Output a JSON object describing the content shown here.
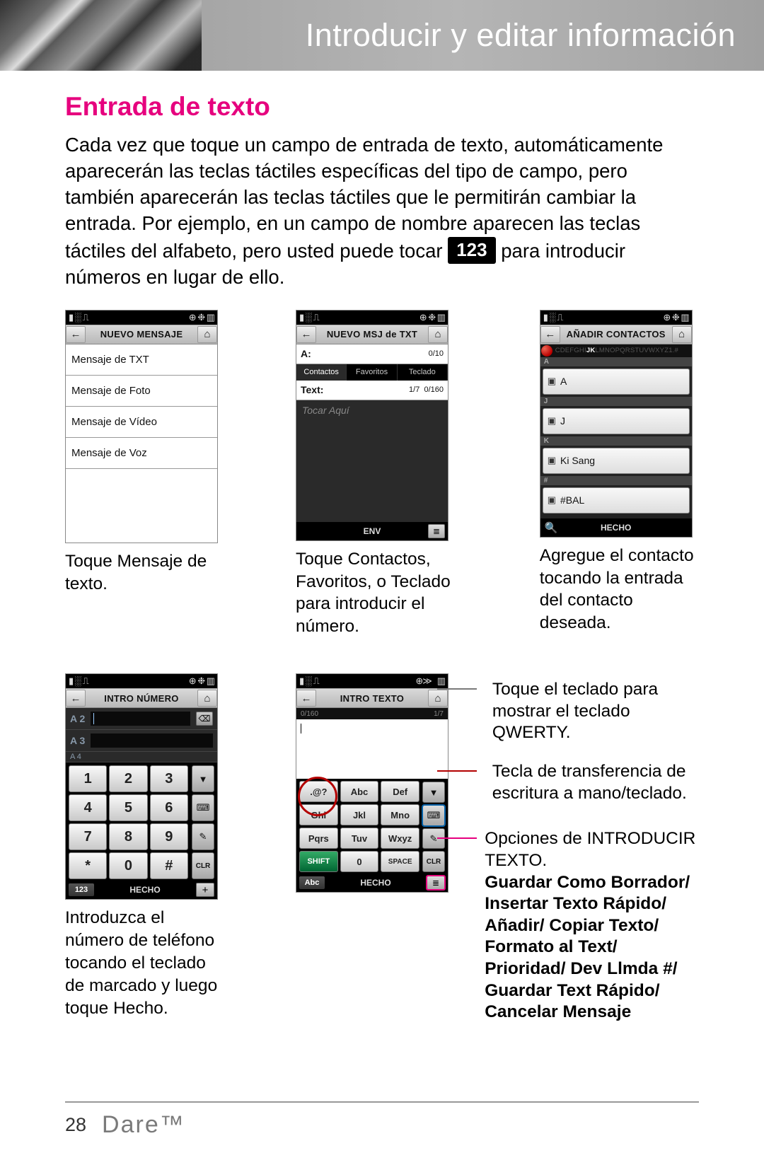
{
  "header": {
    "title": "Introducir y editar información"
  },
  "section": {
    "title": "Entrada de texto"
  },
  "body": {
    "p1a": "Cada vez que toque un campo de entrada de texto, automáticamente aparecerán las teclas táctiles específicas del tipo de campo, pero también aparecerán las teclas táctiles que le permitirán cambiar la entrada. Por ejemplo, en un campo de nombre aparecen las teclas táctiles del alfabeto, pero usted puede tocar ",
    "key_badge": "123",
    "p1b": " para introducir números en lugar de ello."
  },
  "phones": {
    "p1": {
      "title": "NUEVO MENSAJE",
      "items": [
        "Mensaje de TXT",
        "Mensaje de Foto",
        "Mensaje de Vídeo",
        "Mensaje de Voz"
      ],
      "caption": "Toque Mensaje de texto."
    },
    "p2": {
      "title": "NUEVO MSJ de TXT",
      "field_a": "A:",
      "count_a": "0/10",
      "tabs": [
        "Contactos",
        "Favoritos",
        "Teclado"
      ],
      "field_txt": "Text:",
      "count_txt_left": "1/7",
      "count_txt_right": "0/160",
      "placeholder": "Tocar Aquí",
      "send": "ENV",
      "caption": "Toque Contactos, Favoritos, o Teclado para introducir el número."
    },
    "p3": {
      "title": "AÑADIR CONTACTOS",
      "az_pre": "CDEFGHI",
      "az_hot": "JK",
      "az_post": "LMNOPQRSTUVWXYZ1.#",
      "sectA": "A",
      "c1": "A",
      "sectJ": "J",
      "c2": "J",
      "sectK": "K",
      "c3": "Ki Sang",
      "sectHash": "#",
      "c4": "#BAL",
      "done": "HECHO",
      "caption": "Agregue el contacto tocando la entrada del contacto deseada."
    },
    "p4": {
      "title": "INTRO NÚMERO",
      "f2": "A 2",
      "f3": "A 3",
      "f4": "A 4",
      "keys": [
        "1",
        "2",
        "3",
        "4",
        "5",
        "6",
        "7",
        "8",
        "9",
        "*",
        "0",
        "#"
      ],
      "clr": "CLR",
      "mode": "123",
      "done": "HECHO",
      "caption": "Introduzca el número de teléfono tocando el teclado de marcado y luego toque Hecho."
    },
    "p5": {
      "title": "INTRO TEXTO",
      "count_l": "0/160",
      "count_r": "1/7",
      "keys": [
        ".@?",
        "Abc",
        "Def",
        "Ghi",
        "Jkl",
        "Mno",
        "Pqrs",
        "Tuv",
        "Wxyz",
        "SHIFT",
        "0",
        "SPACE"
      ],
      "clr": "CLR",
      "mode": "Abc",
      "done": "HECHO"
    }
  },
  "callouts": {
    "c1": "Toque el teclado para mostrar el teclado QWERTY.",
    "c2": "Tecla de transferencia de escritura a mano/teclado.",
    "c3_label": "Opciones de INTRODUCIR TEXTO.",
    "c3_bold": "Guardar Como Borrador/ Insertar Texto Rápido/ Añadir/ Copiar Texto/ Formato al Text/ Prioridad/ Dev Llmda #/ Guardar Text Rápido/ Cancelar Mensaje"
  },
  "footer": {
    "page": "28",
    "brand": "Dare™"
  }
}
